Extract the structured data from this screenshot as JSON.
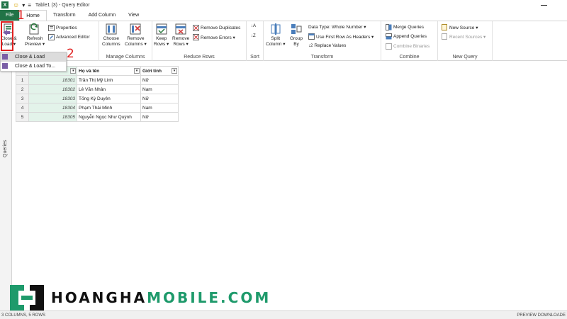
{
  "window": {
    "title": "Table1 (3) - Query Editor",
    "app_letter": "X"
  },
  "tabs": [
    "File",
    "Home",
    "Transform",
    "Add Column",
    "View"
  ],
  "ribbon": {
    "close_load": [
      "Close &",
      "Load ▾"
    ],
    "refresh": [
      "Refresh",
      "Preview ▾"
    ],
    "properties": "Properties",
    "advanced_editor": "Advanced Editor",
    "choose_columns": [
      "Choose",
      "Columns"
    ],
    "remove_columns": [
      "Remove",
      "Columns ▾"
    ],
    "keep_rows": [
      "Keep",
      "Rows ▾"
    ],
    "remove_rows": [
      "Remove",
      "Rows ▾"
    ],
    "remove_duplicates": "Remove Duplicates",
    "remove_errors": "Remove Errors ▾",
    "split_column": [
      "Split",
      "Column ▾"
    ],
    "group_by": [
      "Group",
      "By"
    ],
    "data_type": "Data Type: Whole Number ▾",
    "first_row_headers": "Use First Row As Headers ▾",
    "replace_values": "Replace Values",
    "merge_queries": "Merge Queries",
    "append_queries": "Append Queries",
    "combine_binaries": "Combine Binaries",
    "new_source": "New Source ▾",
    "recent_sources": "Recent Sources ▾",
    "groups": [
      "Manage Columns",
      "Reduce Rows",
      "Sort",
      "Transform",
      "Combine",
      "New Query"
    ]
  },
  "dropdown": [
    "Close & Load",
    "Close & Load To..."
  ],
  "annotations": {
    "one": "1",
    "two": "2"
  },
  "queries_label": "Queries",
  "grid": {
    "headers": [
      "",
      "Họ và tên",
      "Giới tính"
    ],
    "rows": [
      {
        "n": "1",
        "id": "18301",
        "name": "Trần Thị Mỹ Linh",
        "sex": "Nữ"
      },
      {
        "n": "2",
        "id": "18302",
        "name": "Lê Văn Nhân",
        "sex": "Nam"
      },
      {
        "n": "3",
        "id": "18303",
        "name": "Tống Kỳ Duyên",
        "sex": "Nữ"
      },
      {
        "n": "4",
        "id": "18304",
        "name": "Phạm Thái Minh",
        "sex": "Nam"
      },
      {
        "n": "5",
        "id": "18305",
        "name": "Nguyễn Ngọc Như Quỳnh",
        "sex": "Nữ"
      }
    ]
  },
  "status": {
    "left": "3 COLUMNS, 5 ROWS",
    "right": "PREVIEW DOWNLOADE"
  },
  "watermark": {
    "part1": "HOANGHA",
    "part2": "MOBILE.COM"
  },
  "colors": {
    "file_tab": "#217346",
    "annotation": "#e02020",
    "brand": "#1e9a6b"
  }
}
